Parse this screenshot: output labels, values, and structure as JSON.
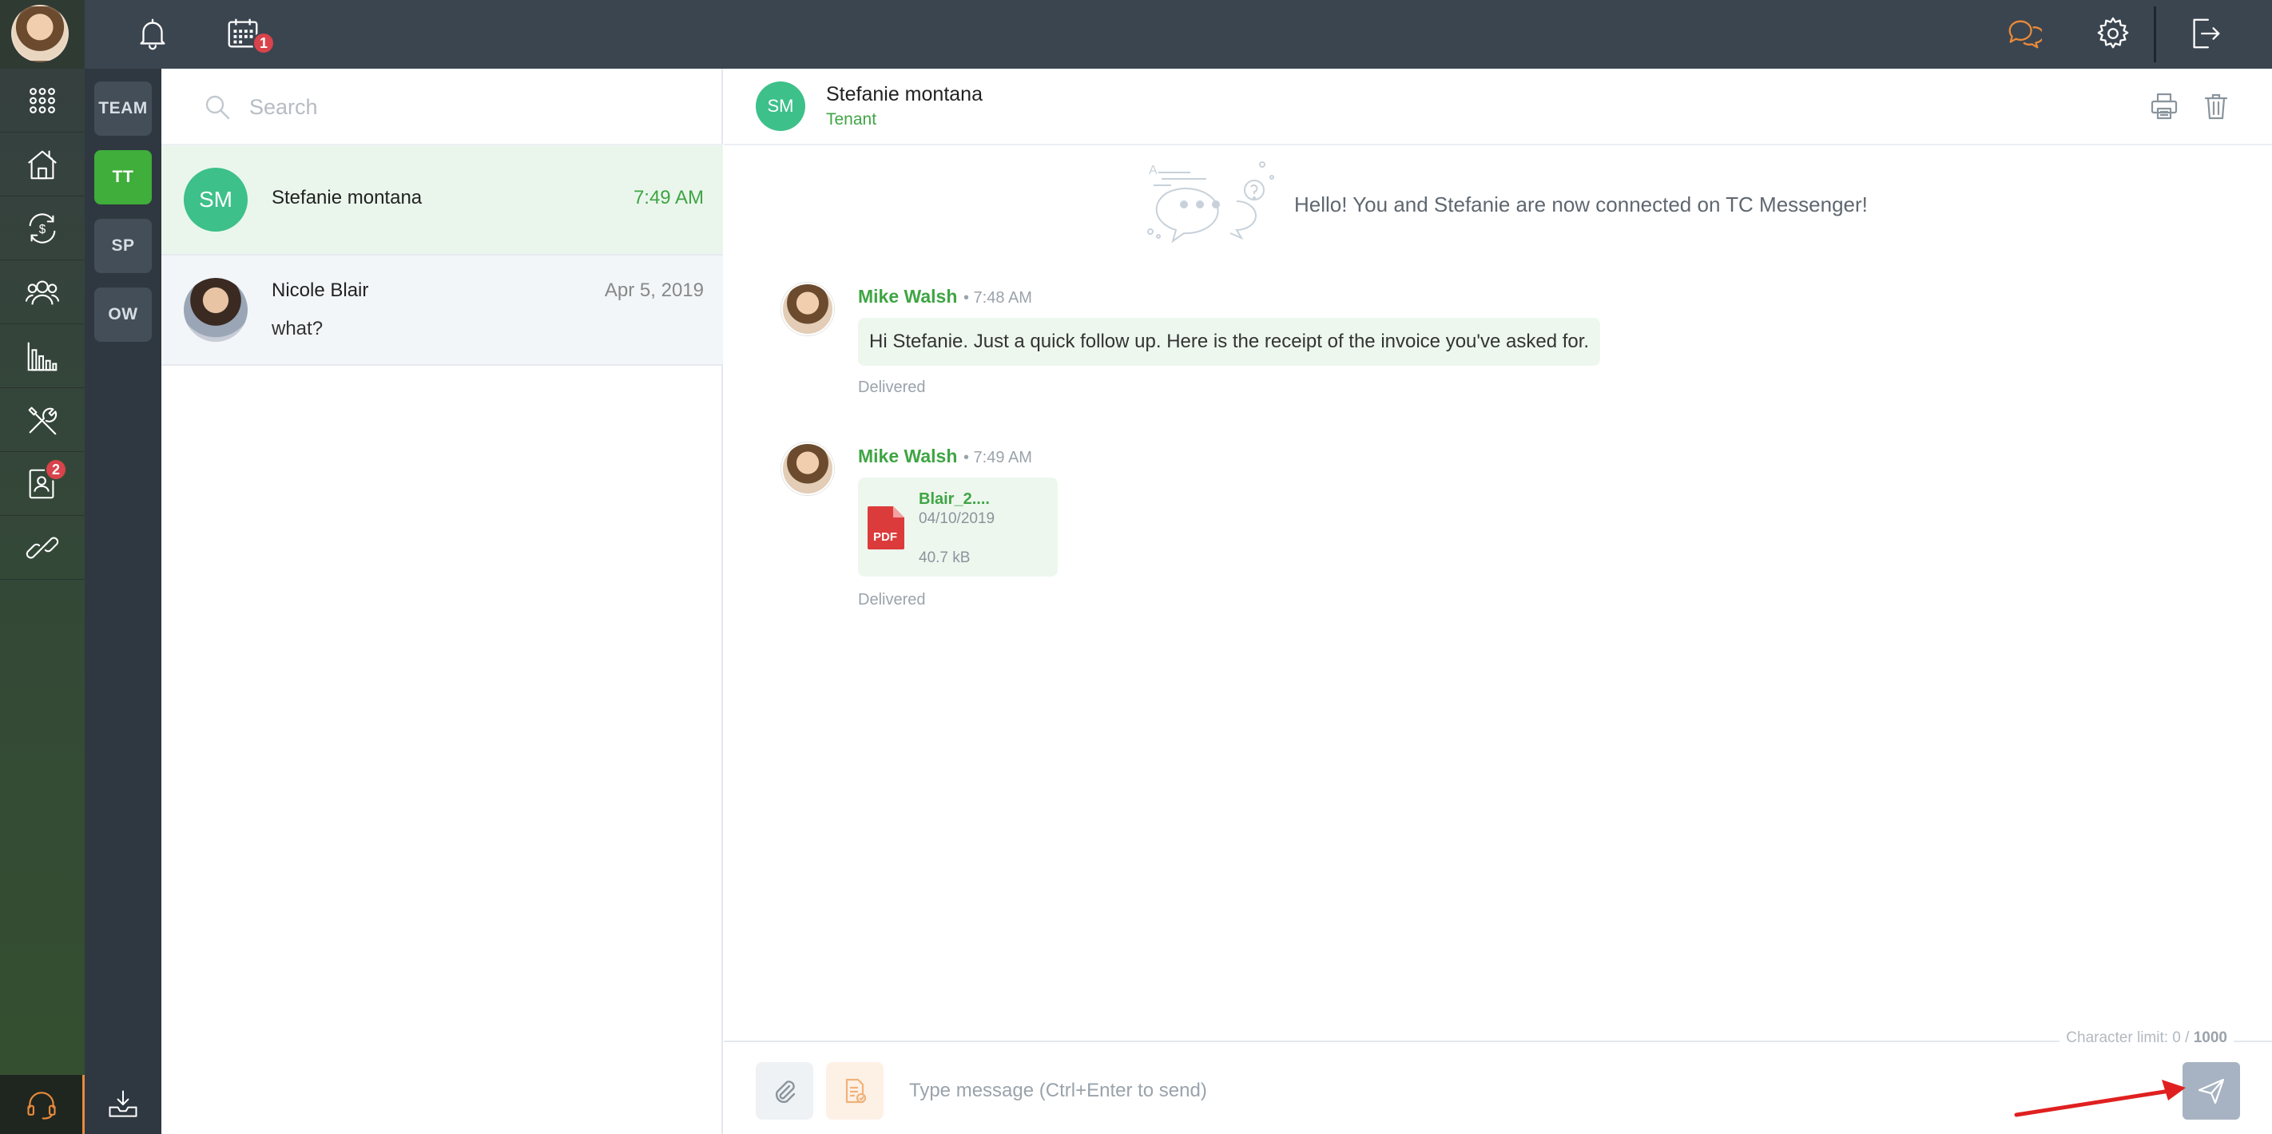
{
  "topbar": {
    "calendar_badge": "1"
  },
  "rail": {
    "contacts_badge": "2"
  },
  "channels": [
    {
      "label": "TEAM"
    },
    {
      "label": "TT"
    },
    {
      "label": "SP"
    },
    {
      "label": "OW"
    }
  ],
  "search": {
    "placeholder": "Search"
  },
  "conversations": [
    {
      "initials": "SM",
      "name": "Stefanie montana",
      "time": "7:49 AM",
      "preview": ""
    },
    {
      "initials": "",
      "name": "Nicole Blair",
      "time": "Apr 5, 2019",
      "preview": "what?"
    }
  ],
  "chat": {
    "initials": "SM",
    "name": "Stefanie montana",
    "role": "Tenant",
    "system_message": "Hello! You and Stefanie are now connected on TC Messenger!",
    "messages": [
      {
        "sender": "Mike Walsh",
        "time": "• 7:48 AM",
        "text": "Hi Stefanie. Just a quick follow up. Here is the receipt of the invoice you've asked for.",
        "status": "Delivered"
      },
      {
        "sender": "Mike Walsh",
        "time": "• 7:49 AM",
        "file": {
          "name": "Blair_2....",
          "type": "PDF",
          "date": "04/10/2019",
          "size": "40.7 kB"
        },
        "status": "Delivered"
      }
    ],
    "char_limit_label": "Character limit: 0 / ",
    "char_limit_max": "1000",
    "composer_placeholder": "Type message (Ctrl+Enter to send)"
  },
  "colors": {
    "accent_green": "#3fa544",
    "topbar_bg": "#3b4550",
    "chat_active_icon": "#e98a3a",
    "badge_red": "#d9434b",
    "send_button": "#a7b3c2",
    "annotation_arrow": "#e02020"
  },
  "icons": {
    "topbar": [
      "user-avatar",
      "bell-icon",
      "calendar-icon",
      "chat-icon",
      "gear-icon",
      "logout-icon"
    ],
    "rail": [
      "apps-grid-icon",
      "house-icon",
      "money-cycle-icon",
      "people-icon",
      "chart-icon",
      "tools-icon",
      "contact-card-icon",
      "link-icon",
      "headset-icon"
    ],
    "composer": [
      "paperclip-icon",
      "template-icon",
      "send-icon"
    ]
  }
}
